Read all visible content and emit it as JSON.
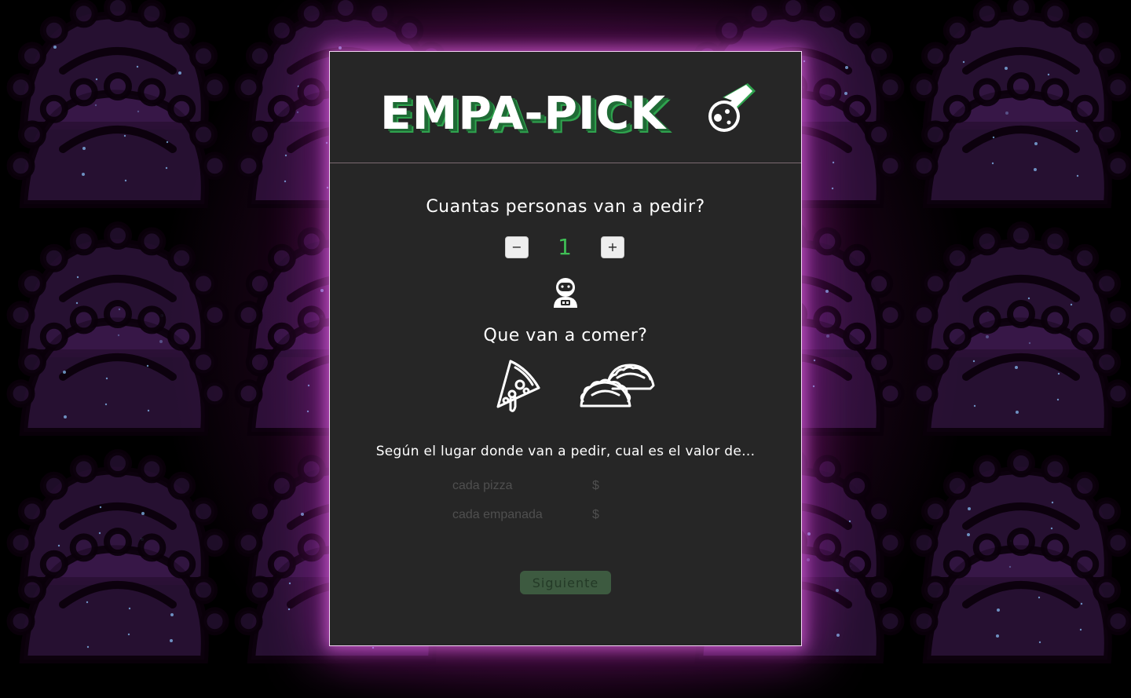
{
  "app": {
    "title": "EMPA-PICK"
  },
  "colors": {
    "accent_green": "#3fbf55",
    "card_bg": "#262626",
    "glow": "#c030c0",
    "button_disabled": "#3d5a40"
  },
  "people": {
    "question": "Cuantas personas van a pedir?",
    "decrement_label": "−",
    "increment_label": "+",
    "count": "1",
    "avatar_icon": "astronaut-icon"
  },
  "food": {
    "question": "Que van a comer?",
    "options": [
      {
        "icon": "pizza-icon"
      },
      {
        "icon": "empanada-icon"
      }
    ]
  },
  "prices": {
    "prompt": "Según el lugar donde van a pedir, cual es el valor de...",
    "pizza_label": "cada pizza",
    "empanada_label": "cada empanada",
    "currency": "$",
    "pizza_value": "",
    "empanada_value": ""
  },
  "actions": {
    "next_label": "Siguiente"
  }
}
